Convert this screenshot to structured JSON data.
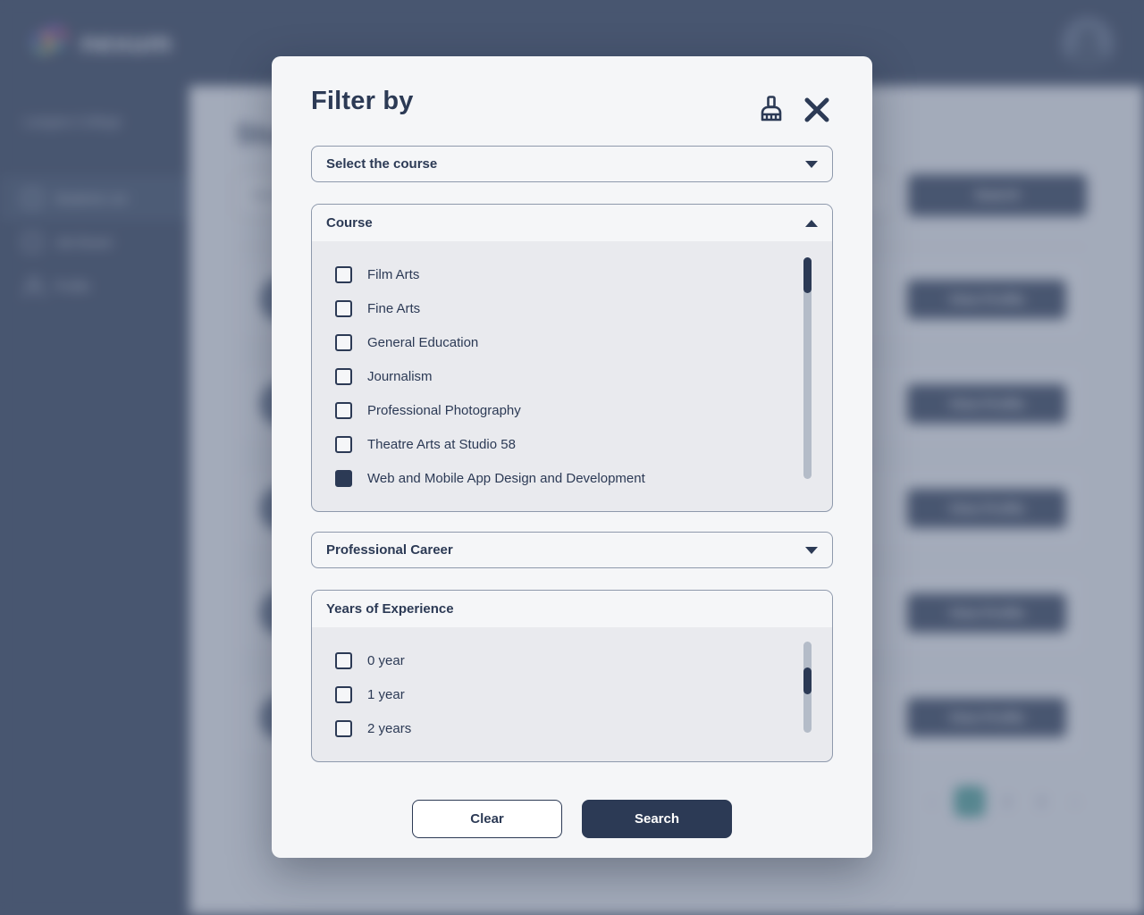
{
  "app": {
    "brand_name": "nexum",
    "brand_mark_icon": "nexum-logo-icon",
    "avatar_icon": "user-avatar",
    "college_name": "Langara College",
    "sidebar": {
      "items": [
        {
          "label": "Students List",
          "icon": "students-list-icon",
          "active": true
        },
        {
          "label": "Job Board",
          "icon": "job-board-icon",
          "active": false
        },
        {
          "label": "Profile",
          "icon": "profile-icon",
          "active": false
        }
      ]
    },
    "page_title": "Students",
    "search_placeholder": "Search",
    "search_button_label": "Search",
    "row_button_label": "View Profile",
    "row_count": 5,
    "pagination": {
      "prev_label": "‹",
      "next_label": "›",
      "pages": [
        "1",
        "2",
        "3"
      ],
      "active_page": "1",
      "active_color": "#3f9e93"
    }
  },
  "modal": {
    "title": "Filter by",
    "clear_icon": "broom-icon",
    "close_icon": "close-icon",
    "course_select": {
      "value": "Select the course",
      "caret_icon": "chevron-down-icon"
    },
    "course_panel": {
      "header": "Course",
      "expanded": true,
      "caret_icon": "chevron-up-icon",
      "options": [
        {
          "label": "Film Arts",
          "checked": false
        },
        {
          "label": "Fine Arts",
          "checked": false
        },
        {
          "label": "General Education",
          "checked": false
        },
        {
          "label": "Journalism",
          "checked": false
        },
        {
          "label": "Professional Photography",
          "checked": false
        },
        {
          "label": "Theatre Arts at Studio 58",
          "checked": false
        },
        {
          "label": "Web and Mobile App Design and Development",
          "checked": true
        }
      ],
      "scrollbar": {
        "thumb_top_pct": 0,
        "thumb_height_pct": 16
      }
    },
    "career_select": {
      "value": "Professional Career",
      "caret_icon": "chevron-down-icon"
    },
    "experience_panel": {
      "header": "Years of Experience",
      "options": [
        {
          "label": "0 year",
          "checked": false
        },
        {
          "label": "1 year",
          "checked": false
        },
        {
          "label": "2 years",
          "checked": false
        }
      ],
      "scrollbar": {
        "thumb_top_pct": 28,
        "thumb_height_pct": 28
      }
    },
    "footer": {
      "clear_label": "Clear",
      "search_label": "Search"
    }
  },
  "colors": {
    "navy": "#2c3a55",
    "modal_bg": "#f5f6f8",
    "panel_bg": "#e9eaee",
    "scroll_track": "#b4bcc8",
    "accent_teal": "#3f9e93"
  }
}
